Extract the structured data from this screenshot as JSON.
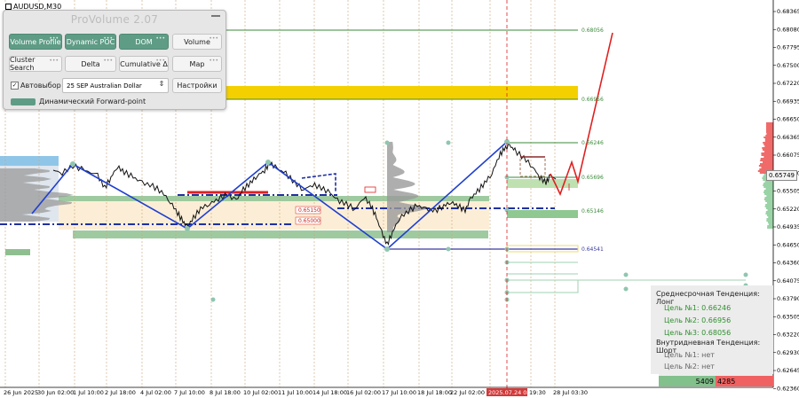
{
  "symbol": "AUDUSD,M30",
  "panel": {
    "title": "ProVolume 2.07",
    "buttons": [
      {
        "label": "Volume Profile",
        "active": true
      },
      {
        "label": "Dynamic POC",
        "active": true
      },
      {
        "label": "DOM",
        "active": true
      },
      {
        "label": "Volume",
        "active": false
      },
      {
        "label": "Cluster Search",
        "active": false
      },
      {
        "label": "Delta",
        "active": false
      },
      {
        "label": "Cumulative Δ",
        "active": false
      },
      {
        "label": "Map",
        "active": false
      }
    ],
    "autoselect_label": "Автовыбор",
    "instrument": "25 SEP Australian Dollar",
    "settings_label": "Настройки",
    "forward_point_label": "Динамический Forward-point"
  },
  "price_axis": [
    "0.68365",
    "0.68080",
    "0.67795",
    "0.67500",
    "0.67220",
    "0.66935",
    "0.66650",
    "0.66365",
    "0.66075",
    "0.65790",
    "0.65505",
    "0.65220",
    "0.64935",
    "0.64650",
    "0.64360",
    "0.64075",
    "0.63790",
    "0.63505",
    "0.63220",
    "0.62930",
    "0.62645",
    "0.62360"
  ],
  "current_price": "0.65749",
  "time_axis": [
    "26 Jun 2025",
    "30 Jun 02:00",
    "1 Jul 10:00",
    "2 Jul 18:00",
    "4 Jul 02:00",
    "7 Jul 10:00",
    "8 Jul 18:00",
    "10 Jul 02:00",
    "11 Jul 10:00",
    "14 Jul 18:00",
    "16 Jul 02:00",
    "17 Jul 10:00",
    "18 Jul 18:00",
    "22 Jul 02:00",
    "2025.07.24 08:30",
    "19:30",
    "28 Jul 03:30"
  ],
  "levels": [
    {
      "value": "0.68056",
      "color": "#3a8a3a"
    },
    {
      "value": "0.66956",
      "color": "#3a8a3a"
    },
    {
      "value": "0.66246",
      "color": "#3a8a3a"
    },
    {
      "value": "0.65696",
      "color": "#3a8a3a"
    },
    {
      "value": "0.65146",
      "color": "#3a8a3a"
    },
    {
      "value": "0.64541",
      "color": "#3a3aa0"
    },
    {
      "value": "0.65150",
      "color": "#c02020"
    },
    {
      "value": "0.65000",
      "color": "#c02020"
    }
  ],
  "info_box": {
    "medium_trend": "Среднесрочная Тенденция: Лонг",
    "medium_targets": [
      "Цель №1: 0.66246",
      "Цель №2: 0.66956",
      "Цель №3: 0.68056"
    ],
    "intraday_trend": "Внутридневная Тенденция: Шорт",
    "intraday_targets": [
      "Цель №1: нет",
      "Цель №2: нет"
    ]
  },
  "volume_bar": {
    "buy": "5409",
    "sell": "4285"
  },
  "colors": {
    "accent": "#5f9c86",
    "zigzag": "#1f3fd0",
    "forecast": "#e02020",
    "zone_yellow": "#f5d000"
  }
}
